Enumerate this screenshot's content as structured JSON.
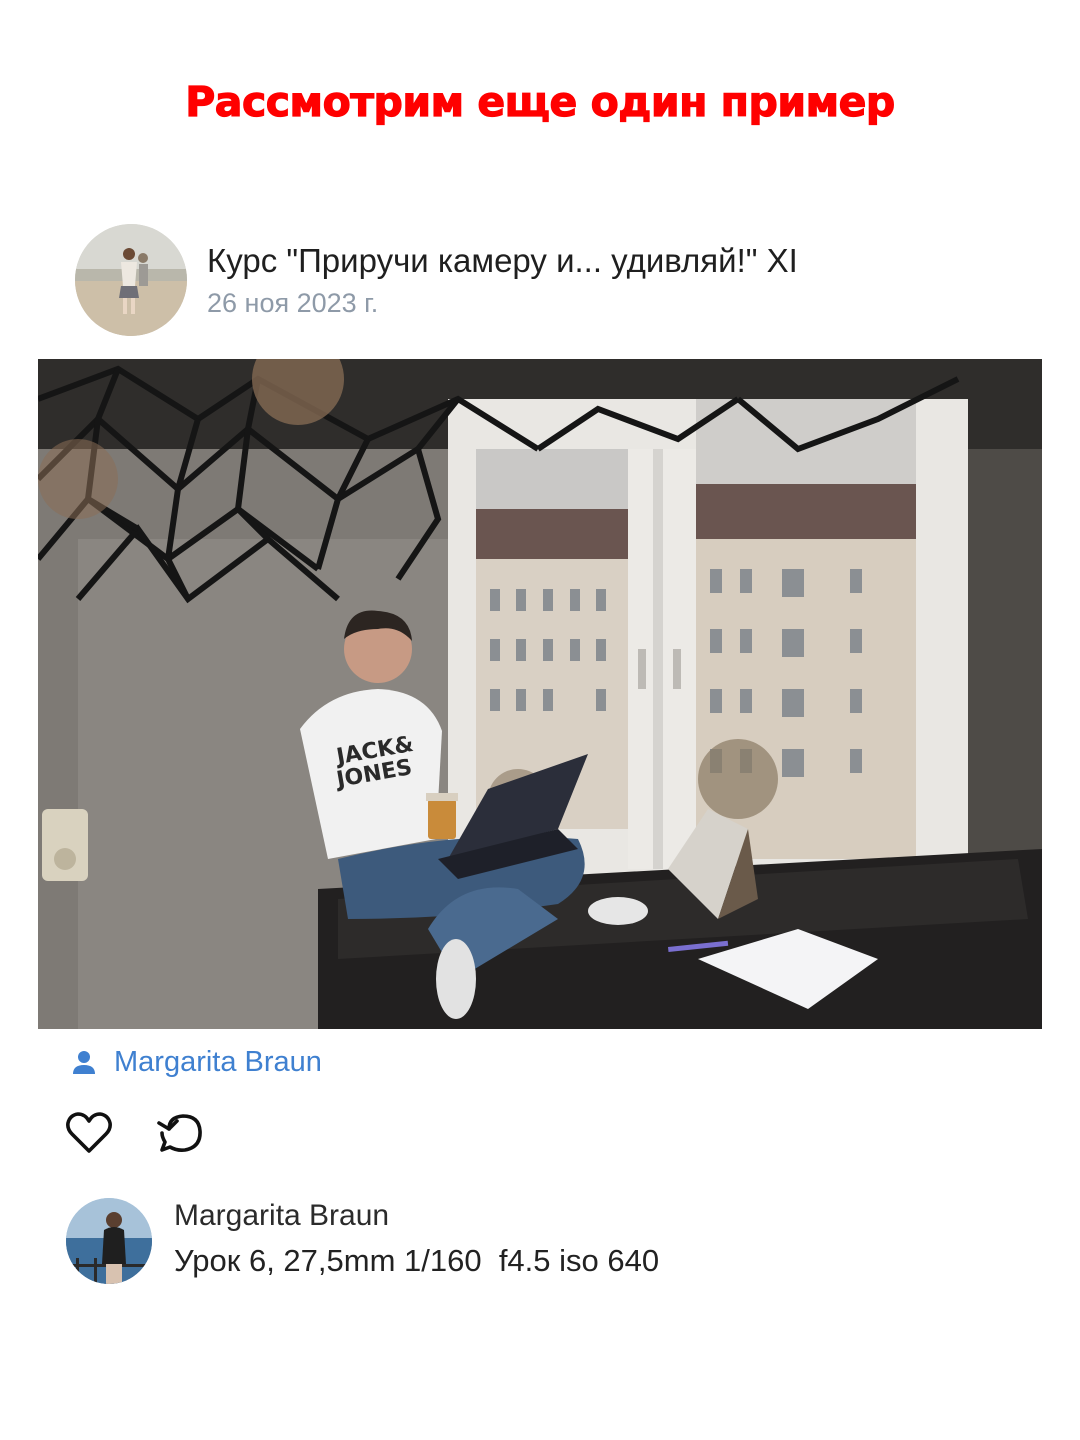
{
  "banner": {
    "text": "Рассмотрим еще один пример",
    "color": "#ff0000"
  },
  "post": {
    "title": "Курс \"Приручи камеру и... удивляй!\" XI",
    "date": "26 ноя 2023 г.",
    "photo_alt": "photo"
  },
  "author": {
    "name": "Margarita Braun",
    "icon": "person-icon",
    "link_color": "#3f80d0"
  },
  "actions": {
    "like_icon": "heart-icon",
    "share_icon": "repost-icon"
  },
  "comment": {
    "author": "Margarita Braun",
    "text": "Урок 6, 27,5mm 1/160  f4.5 iso 640"
  }
}
